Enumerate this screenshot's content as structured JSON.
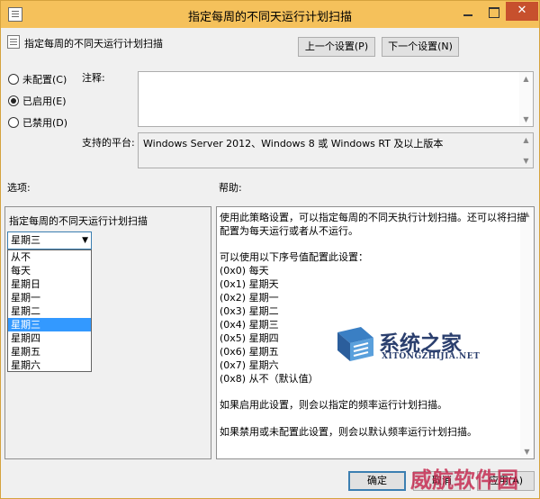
{
  "window": {
    "title": "指定每周的不同天运行计划扫描",
    "close_label": "✕"
  },
  "policy": {
    "name": "指定每周的不同天运行计划扫描",
    "prev_label": "上一个设置(P)",
    "next_label": "下一个设置(N)"
  },
  "state": {
    "options": [
      {
        "label": "未配置(C)",
        "checked": false
      },
      {
        "label": "已启用(E)",
        "checked": true
      },
      {
        "label": "已禁用(D)",
        "checked": false
      }
    ]
  },
  "comment": {
    "label": "注释:",
    "value": ""
  },
  "platform": {
    "label": "支持的平台:",
    "value": "Windows Server 2012、Windows 8 或 Windows RT 及以上版本"
  },
  "options_panel": {
    "label": "选项:",
    "setting_label": "指定每周的不同天运行计划扫描",
    "selected": "星期三",
    "items": [
      "从不",
      "每天",
      "星期日",
      "星期一",
      "星期二",
      "星期三",
      "星期四",
      "星期五",
      "星期六"
    ],
    "selected_index": 5
  },
  "help": {
    "label": "帮助:",
    "lines": [
      "使用此策略设置，可以指定每周的不同天执行计划扫描。还可以将扫描",
      "配置为每天运行或者从不运行。",
      "",
      "可以使用以下序号值配置此设置：",
      "(0x0) 每天",
      "(0x1) 星期天",
      "(0x2) 星期一",
      "(0x3) 星期二",
      "(0x4) 星期三",
      "(0x5) 星期四",
      "(0x6) 星期五",
      "(0x7) 星期六",
      "(0x8) 从不（默认值）",
      "",
      "如果启用此设置，则会以指定的频率运行计划扫描。",
      "",
      "如果禁用或未配置此设置，则会以默认频率运行计划扫描。"
    ]
  },
  "footer": {
    "ok_label": "确定",
    "cancel_label": "取消",
    "apply_label": "应用(A)"
  },
  "watermark": {
    "site_name": "系统之家",
    "site_domain": "XITONGZHIJIA.NET",
    "brand2": "威航软件园"
  }
}
